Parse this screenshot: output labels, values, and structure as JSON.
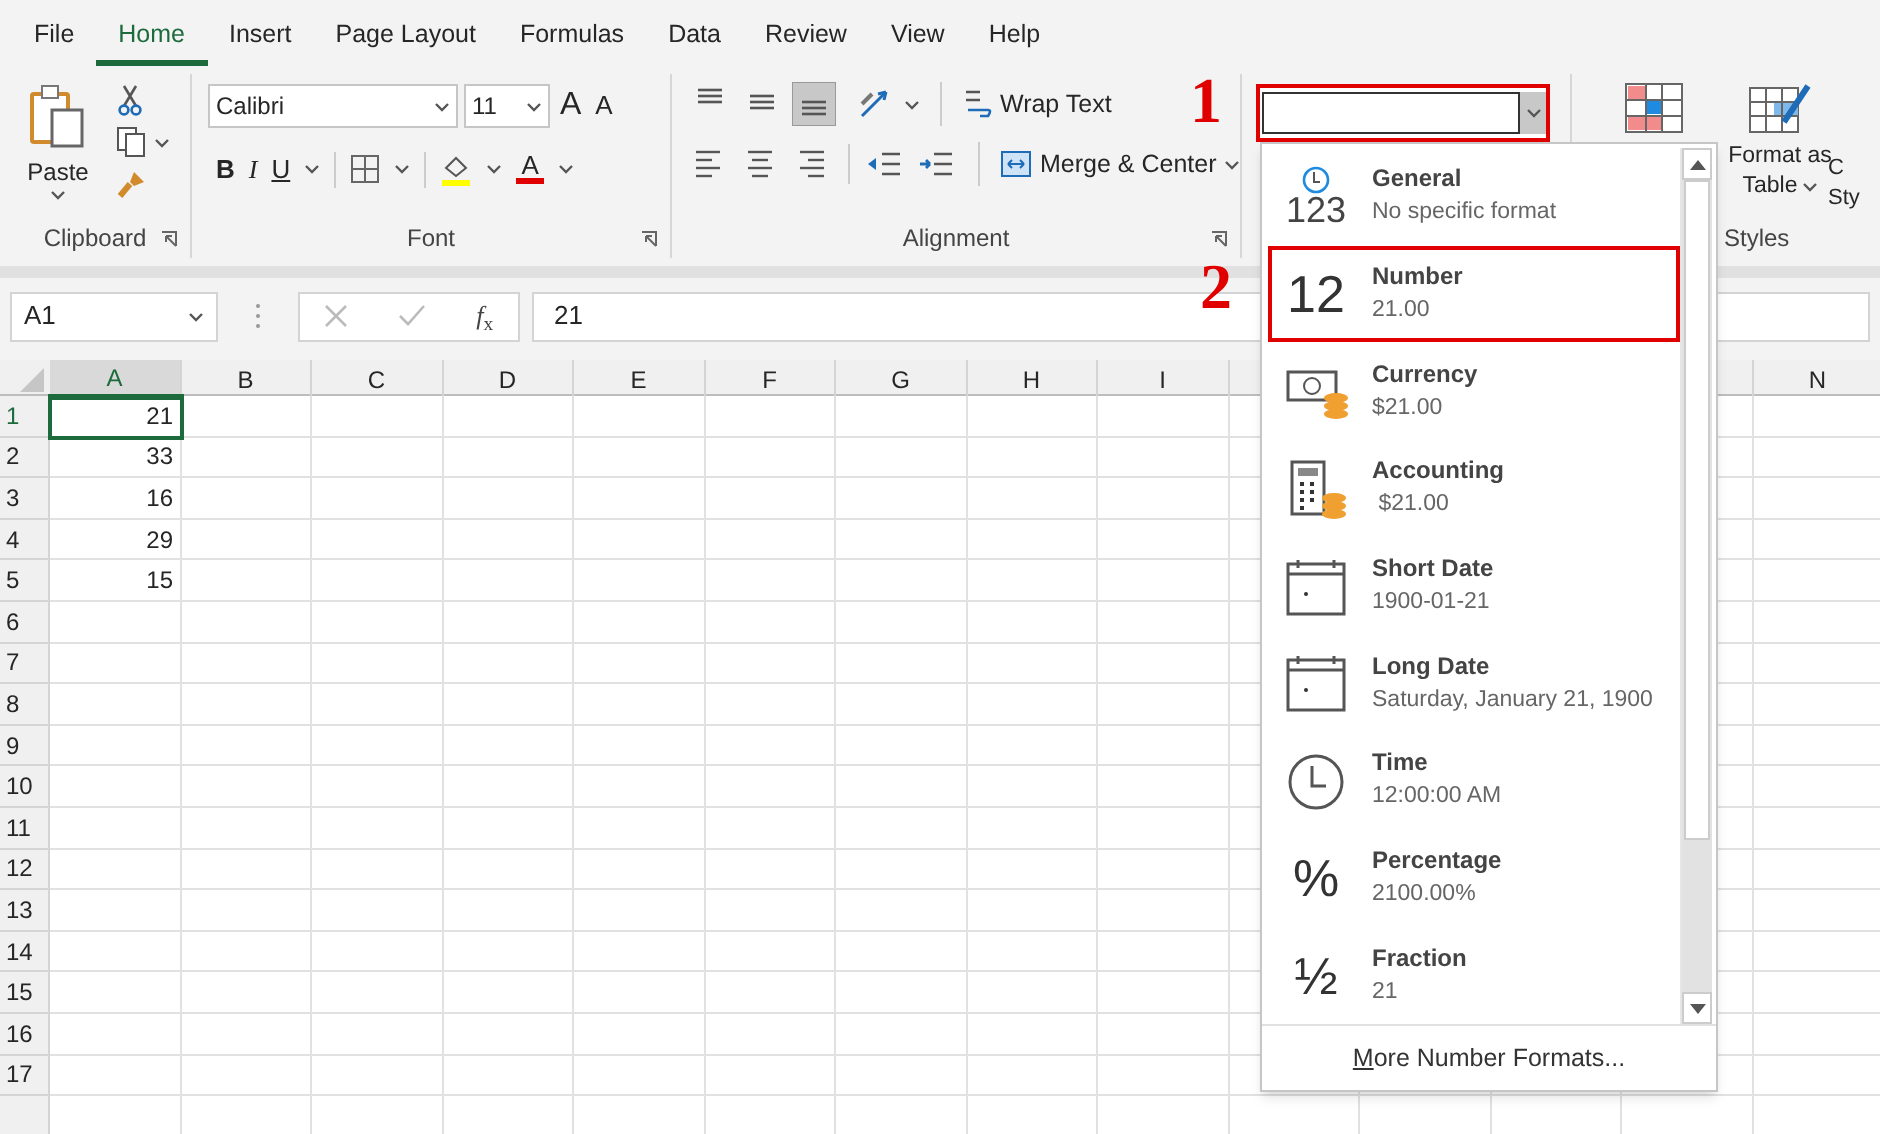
{
  "menu_tabs": [
    {
      "label": "File",
      "selected": false
    },
    {
      "label": "Home",
      "selected": true
    },
    {
      "label": "Insert",
      "selected": false
    },
    {
      "label": "Page Layout",
      "selected": false
    },
    {
      "label": "Formulas",
      "selected": false
    },
    {
      "label": "Data",
      "selected": false
    },
    {
      "label": "Review",
      "selected": false
    },
    {
      "label": "View",
      "selected": false
    },
    {
      "label": "Help",
      "selected": false
    }
  ],
  "clipboard": {
    "paste": "Paste",
    "group": "Clipboard"
  },
  "font": {
    "name": "Calibri",
    "size": "11",
    "grow": "A",
    "shrink": "A",
    "bold": "B",
    "italic": "I",
    "underline": "U",
    "color_letter": "A",
    "group": "Font"
  },
  "alignment": {
    "vertical": [
      {
        "selected": false
      },
      {
        "selected": false
      },
      {
        "selected": true
      }
    ],
    "wrap": "Wrap Text",
    "merge": "Merge & Center",
    "group": "Alignment"
  },
  "number_format": {
    "marked": true
  },
  "styles": {
    "format_as_table": [
      "Format as",
      "Table"
    ],
    "cell_styles": [
      "C",
      "Sty"
    ],
    "group": "Styles"
  },
  "formula_bar": {
    "name_box": "A1",
    "function_label": "*f*$_{x}$",
    "value": "21"
  },
  "sheet": {
    "columns": [
      "A",
      "B",
      "C",
      "D",
      "E",
      "F",
      "G",
      "H",
      "I"
    ],
    "far_columns": [
      "N"
    ],
    "rows": [
      {
        "label": "1",
        "value": "21",
        "selected": true
      },
      {
        "label": "2",
        "value": "33",
        "selected": false
      },
      {
        "label": "3",
        "value": "16",
        "selected": false
      },
      {
        "label": "4",
        "value": "29",
        "selected": false
      },
      {
        "label": "5",
        "value": "15",
        "selected": false
      },
      {
        "label": "6"
      },
      {
        "label": "7"
      },
      {
        "label": "8"
      },
      {
        "label": "9"
      },
      {
        "label": "10"
      },
      {
        "label": "11"
      },
      {
        "label": "12"
      },
      {
        "label": "13"
      },
      {
        "label": "14"
      },
      {
        "label": "15"
      },
      {
        "label": "16"
      },
      {
        "label": "17"
      }
    ]
  },
  "format_menu": {
    "items": [
      {
        "kind": "general",
        "glyph": "123",
        "title": "General",
        "example": "No specific format",
        "marked": false
      },
      {
        "kind": "number",
        "glyph": "12",
        "title": "Number",
        "example": "21.00",
        "marked": true
      },
      {
        "kind": "currency",
        "title": "Currency",
        "example": "$21.00",
        "marked": false
      },
      {
        "kind": "accounting",
        "title": "Accounting",
        "example": " $21.00",
        "marked": false
      },
      {
        "kind": "short_date",
        "title": "Short Date",
        "example": "1900-01-21",
        "marked": false
      },
      {
        "kind": "long_date",
        "title": "Long Date",
        "example": "Saturday, January 21, 1900",
        "marked": false
      },
      {
        "kind": "time",
        "title": "Time",
        "example": "12:00:00 AM",
        "marked": false
      },
      {
        "kind": "percentage",
        "glyph": "%",
        "title": "Percentage",
        "example": "2100.00%",
        "marked": false
      },
      {
        "kind": "fraction",
        "glyph": "½",
        "title": "Fraction",
        "example": "21",
        "marked": false
      }
    ],
    "footer": "More Number Formats..."
  },
  "annotations": [
    {
      "label": "1"
    },
    {
      "label": "2"
    }
  ]
}
